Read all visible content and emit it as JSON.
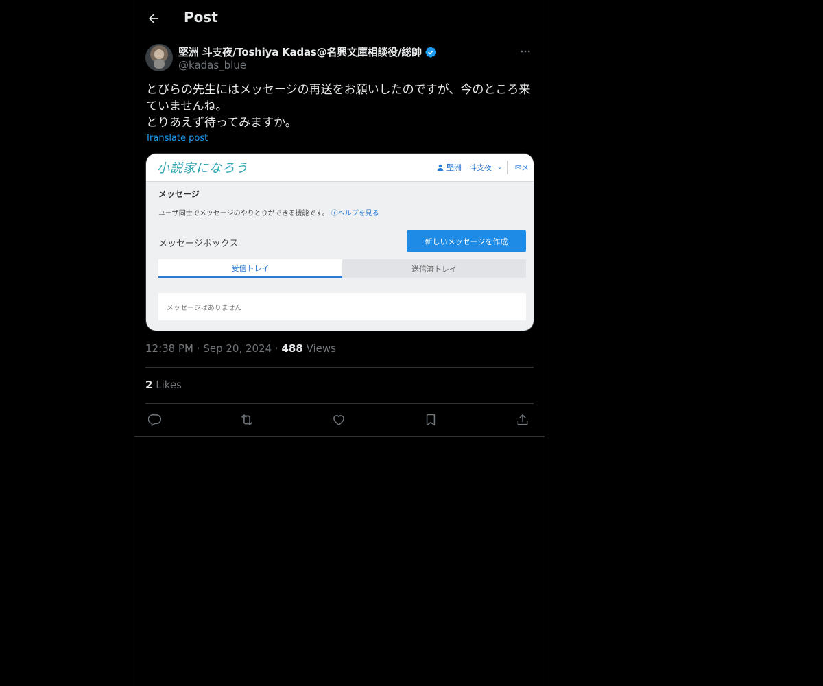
{
  "header": {
    "title": "Post"
  },
  "author": {
    "display_name": "堅洲 斗支夜/Toshiya Kadas@名興文庫相談役/総帥",
    "handle": "@kadas_blue",
    "verified": true
  },
  "post": {
    "text": "とびらの先生にはメッセージの再送をお願いしたのですが、今のところ来ていませんね。\nとりあえず待ってみますか。",
    "translate_label": "Translate post",
    "time": "12:38 PM",
    "date": "Sep 20, 2024",
    "views_count": "488",
    "views_label": "Views",
    "likes_count": "2",
    "likes_label": "Likes"
  },
  "media": {
    "logo": "小説家になろう",
    "user": "堅洲　斗支夜",
    "mail_label": "メ",
    "heading": "メッセージ",
    "description": "ユーザ同士でメッセージのやりとりができる機能です。",
    "help_link": "ヘルプを見る",
    "box_title": "メッセージボックス",
    "new_message_button": "新しいメッセージを作成",
    "tabs": [
      "受信トレイ",
      "送信済トレイ"
    ],
    "empty_message": "メッセージはありません"
  },
  "colors": {
    "background": "#000000",
    "accent": "#1d9bf0",
    "muted": "#71767b",
    "border": "#2f3336"
  },
  "icons": [
    "back-arrow-icon",
    "verified-badge-icon",
    "more-icon",
    "reply-icon",
    "repost-icon",
    "like-icon",
    "bookmark-icon",
    "share-icon"
  ]
}
